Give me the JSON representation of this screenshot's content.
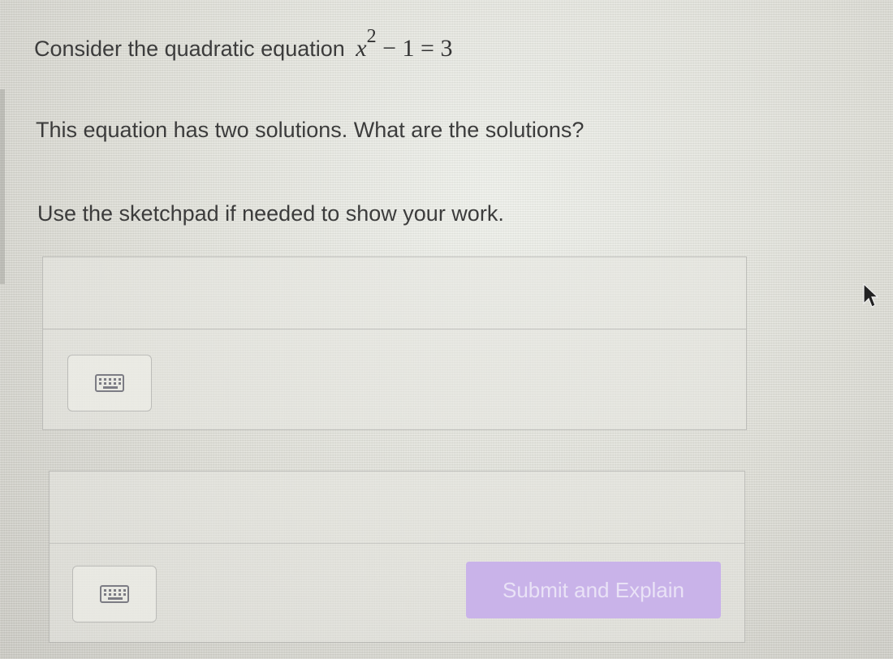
{
  "question": {
    "prefix": "Consider the quadratic equation",
    "equation": {
      "variable": "x",
      "exponent": "2",
      "rest": " − 1 = 3"
    }
  },
  "prompt": "This equation has two solutions. What are the solutions?",
  "instruction": "Use the sketchpad if needed to show your work.",
  "answer_boxes": [
    {
      "value": "",
      "keyboard_icon": "keyboard-icon"
    },
    {
      "value": "",
      "keyboard_icon": "keyboard-icon"
    }
  ],
  "submit": {
    "label": "Submit and Explain",
    "color": "#c9b3e9",
    "enabled": false
  },
  "cursor_icon": "mouse-pointer-icon"
}
